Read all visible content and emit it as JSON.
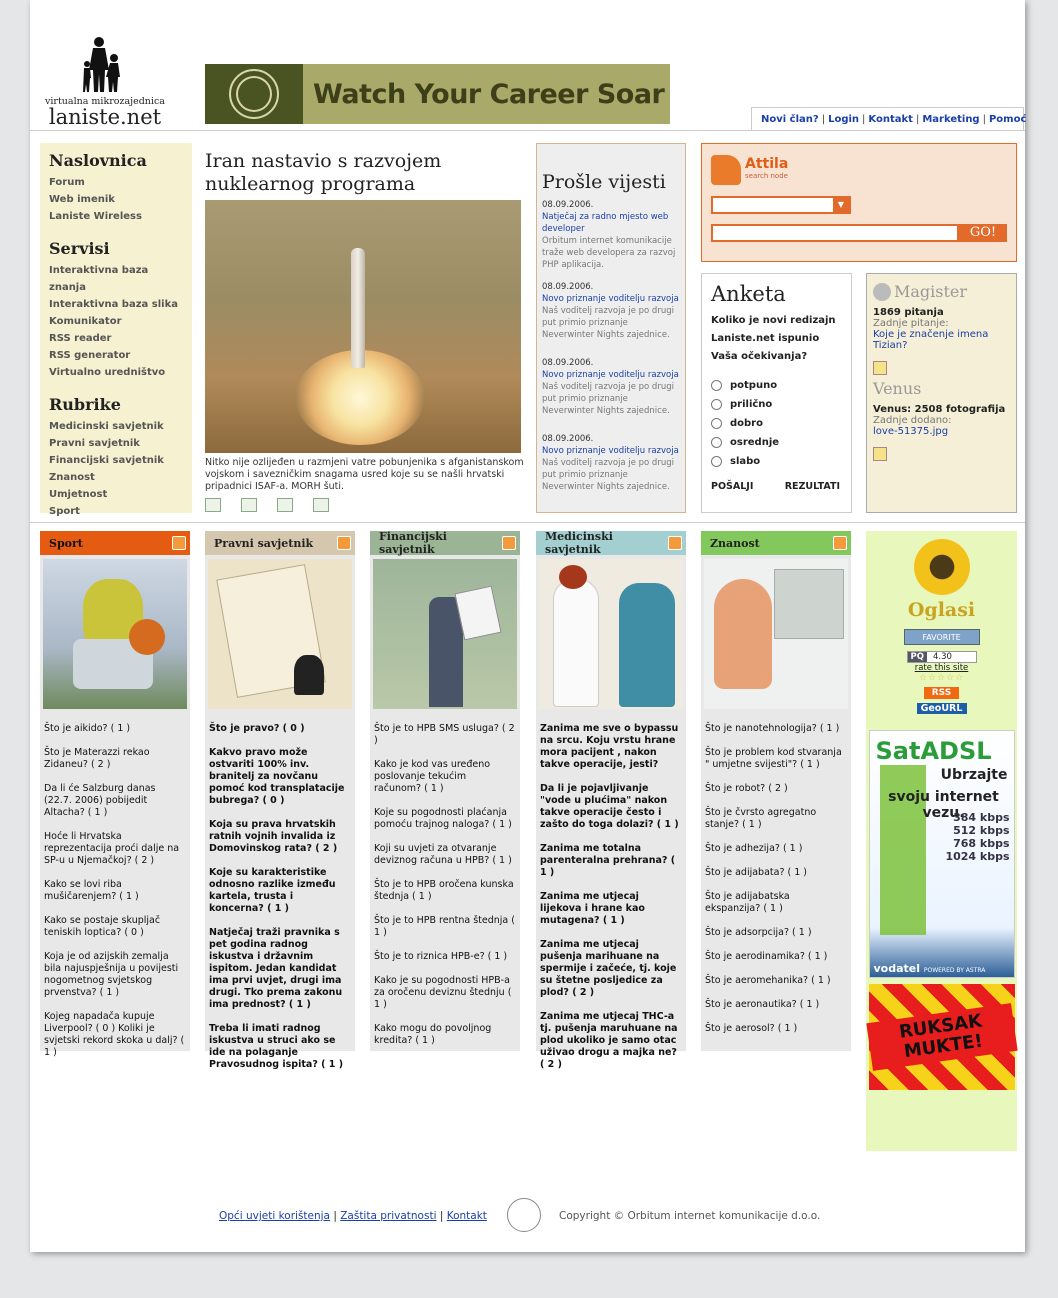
{
  "header": {
    "logo_tagline": "virtualna mikrozajednica",
    "logo_name": "laniste.net",
    "banner_slogan": "Watch Your Career Soar",
    "topnav": [
      "Novi član?",
      "Login",
      "Kontakt",
      "Marketing",
      "Pomoć"
    ]
  },
  "leftnav": {
    "sections": [
      {
        "title": "Naslovnica",
        "items": [
          "Forum",
          "Web imenik",
          "Laniste Wireless"
        ]
      },
      {
        "title": "Servisi",
        "items": [
          "Interaktivna baza znanja",
          "Interaktivna baza slika",
          "Komunikator",
          "RSS reader",
          "RSS generator",
          "Virtualno uredništvo"
        ]
      },
      {
        "title": "Rubrike",
        "items": [
          "Medicinski savjetnik",
          "Pravni savjetnik",
          "Financijski savjetnik",
          "Znanost",
          "Umjetnost",
          "Sport"
        ]
      }
    ]
  },
  "story": {
    "title": "Iran nastavio s razvojem nuklearnog programa",
    "caption": "Nitko nije ozlijeđen u razmjeni vatre pobunjenika s afganistanskom vojskom i savezničkim snagama usred koje su se našli hrvatski pripadnici ISAF-a. MORH šuti."
  },
  "news": {
    "title": "Prošle vijesti",
    "items": [
      {
        "date": "08.09.2006.",
        "link": "Natječaj za radno mjesto web developer",
        "text": "Orbitum internet komunikacije traže web developera za razvoj PHP aplikacija."
      },
      {
        "date": "08.09.2006.",
        "link": "Novo priznanje voditelju razvoja",
        "text": "Naš voditelj razvoja je po drugi put primio priznanje Neverwinter Nights zajednice."
      },
      {
        "date": "08.09.2006.",
        "link": "Novo priznanje voditelju razvoja",
        "text": "Naš voditelj razvoja je po drugi put primio priznanje Neverwinter Nights zajednice."
      },
      {
        "date": "08.09.2006.",
        "link": "Novo priznanje voditelju razvoja",
        "text": "Naš voditelj razvoja je po drugi put primio priznanje Neverwinter Nights zajednice."
      }
    ]
  },
  "search": {
    "brand": "Attila",
    "brand_sub": "search node",
    "button": "GO!"
  },
  "poll": {
    "title": "Anketa",
    "question": "Koliko je novi redizajn Laniste.net ispunio Vaša očekivanja?",
    "options": [
      "potpuno",
      "prilično",
      "dobro",
      "osrednje",
      "slabo"
    ],
    "submit": "POŠALJI",
    "results": "REZULTATI"
  },
  "magister": {
    "title": "Magister",
    "count": "1869 pitanja",
    "last_label": "Zadnje pitanje:",
    "last_link": "Koje je značenje imena Tizian?",
    "venus_title": "Venus",
    "venus_count": "Venus: 2508 fotografija",
    "venus_last_label": "Zadnje dodano:",
    "venus_last_link": "love-51375.jpg"
  },
  "columns": [
    {
      "title": "Sport",
      "items": [
        {
          "t": "Što je aikido? ( 1 )",
          "b": false
        },
        {
          "t": "Što je Materazzi rekao Zidaneu? ( 2 )",
          "b": false
        },
        {
          "t": "Da li će Salzburg danas (22.7. 2006) pobijedit Altacha? ( 1 )",
          "b": false
        },
        {
          "t": "Hoće li Hrvatska reprezentacija proći dalje na SP-u u Njemačkoj? ( 2 )",
          "b": false
        },
        {
          "t": "Kako se lovi riba mušičarenjem? ( 1 )",
          "b": false
        },
        {
          "t": "Kako se postaje skupljač teniskih loptica? ( 0 )",
          "b": false
        },
        {
          "t": "Koja je od azijskih zemalja bila najuspješnija u povijesti nogometnog svjetskog prvenstva? ( 1 )",
          "b": false
        },
        {
          "t": "Kojeg napadača kupuje Liverpool? ( 0 ) Koliki je svjetski rekord skoka u dalj? ( 1 )",
          "b": false
        }
      ]
    },
    {
      "title": "Pravni savjetnik",
      "items": [
        {
          "t": "Što je pravo? ( 0 )",
          "b": true
        },
        {
          "t": "Kakvo pravo može ostvariti 100% inv. branitelj za novčanu pomoć kod transplatacije bubrega? ( 0 )",
          "b": true
        },
        {
          "t": "Koja su prava hrvatskih ratnih vojnih invalida iz Domovinskog rata? ( 2 )",
          "b": true
        },
        {
          "t": "Koje su karakteristike odnosno razlike između kartela, trusta i koncerna? ( 1 )",
          "b": true
        },
        {
          "t": "Natječaj traži pravnika s pet godina radnog iskustva i državnim ispitom. Jedan kandidat ima prvi uvjet, drugi ima drugi. Tko prema zakonu ima prednost? ( 1 )",
          "b": true
        },
        {
          "t": "Treba li imati radnog iskustva u struci ako se ide na polaganje Pravosudnog ispita? ( 1 )",
          "b": true
        }
      ]
    },
    {
      "title": "Financijski savjetnik",
      "items": [
        {
          "t": "Što je to HPB SMS usluga? ( 2 )",
          "b": false
        },
        {
          "t": "Kako je kod vas uređeno poslovanje tekućim računom? ( 1 )",
          "b": false
        },
        {
          "t": "Koje su pogodnosti plaćanja pomoću trajnog naloga? ( 1 )",
          "b": false
        },
        {
          "t": "Koji su uvjeti za otvaranje deviznog računa u HPB? ( 1 )",
          "b": false
        },
        {
          "t": "Što je to HPB oročena kunska štednja ( 1 )",
          "b": false
        },
        {
          "t": "Što je to HPB rentna štednja ( 1 )",
          "b": false
        },
        {
          "t": "Što je to riznica HPB-e? ( 1 )",
          "b": false
        },
        {
          "t": "Kako je su pogodnosti HPB-a za oročenu deviznu štednju ( 1 )",
          "b": false
        },
        {
          "t": "Kako mogu do povoljnog kredita? ( 1 )",
          "b": false
        }
      ]
    },
    {
      "title": "Medicinski savjetnik",
      "items": [
        {
          "t": "Zanima me sve o bypassu na srcu. Koju vrstu hrane mora pacijent , nakon takve operacije, jesti?",
          "b": true
        },
        {
          "t": "Da li je pojavljivanje \"vode u plućima\" nakon takve operacije često i zašto do toga dolazi? ( 1 )",
          "b": true
        },
        {
          "t": "Zanima me totalna parenteralna prehrana? ( 1 )",
          "b": true
        },
        {
          "t": "Zanima me utjecaj lijekova i hrane kao mutagena? ( 1 )",
          "b": true
        },
        {
          "t": "Zanima me utjecaj pušenja marihuane na spermije i začeće, tj. koje su štetne posljedice za plod? ( 2 )",
          "b": true
        },
        {
          "t": "Zanima me utjecaj THC-a tj. pušenja maruhuane na plod ukoliko je samo otac uživao drogu a majka ne? ( 2 )",
          "b": true
        }
      ]
    },
    {
      "title": "Znanost",
      "items": [
        {
          "t": "Što je nanotehnologija? ( 1 )",
          "b": false
        },
        {
          "t": "Što je problem kod stvaranja \" umjetne svijesti\"? ( 1 )",
          "b": false
        },
        {
          "t": "Što je robot? ( 2 )",
          "b": false
        },
        {
          "t": "Što je čvrsto agregatno stanje? ( 1 )",
          "b": false
        },
        {
          "t": "Što je adhezija? ( 1 )",
          "b": false
        },
        {
          "t": "Što je adijabata? ( 1 )",
          "b": false
        },
        {
          "t": "Što je adijabatska ekspanzija? ( 1 )",
          "b": false
        },
        {
          "t": "Što je adsorpcija? ( 1 )",
          "b": false
        },
        {
          "t": "Što je aerodinamika? ( 1 )",
          "b": false
        },
        {
          "t": "Što je aeromehanika? ( 1 )",
          "b": false
        },
        {
          "t": "Što je aeronautika? ( 1 )",
          "b": false
        },
        {
          "t": "Što je aerosol? ( 1 )",
          "b": false
        }
      ]
    }
  ],
  "ads": {
    "title": "Oglasi",
    "favorite": "FAVORITE",
    "pq_label": "PQ",
    "pq_value": "4.30",
    "rate": "rate this site",
    "rss": "RSS",
    "geourl": "GeoURL",
    "sat_brand": "SatADSL",
    "sat_line1": "Ubrzajte",
    "sat_line2": "svoju internet vezu.",
    "sat_speeds": [
      "384 kbps",
      "512 kbps",
      "768 kbps",
      "1024 kbps"
    ],
    "sat_footer": "vodatel",
    "sat_powered": "POWERED BY ASTRA",
    "ruksak": "RUKSAK MUKTE!"
  },
  "footer": {
    "links": [
      "Opći uvjeti korištenja",
      "Zaštita privatnosti",
      "Kontakt"
    ],
    "copyright": "Copyright © Orbitum internet komunikacije d.o.o."
  },
  "colors": {
    "accent": "#e26a2a",
    "link": "#1a3fa8",
    "nav_bg": "#f6f1d0"
  }
}
